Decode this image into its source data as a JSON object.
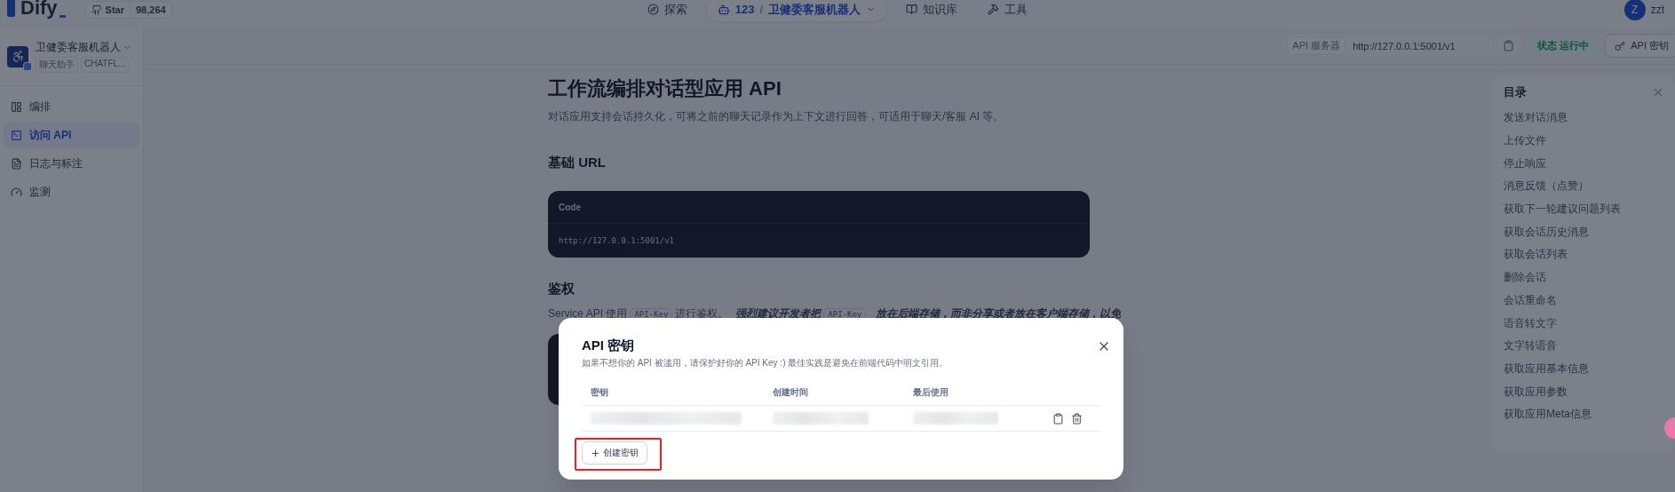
{
  "top_nav": {
    "logo": "Dify",
    "star": {
      "label": "Star",
      "count": "98,264"
    },
    "items": [
      {
        "kind": "explore",
        "label": "探索",
        "selected": false
      },
      {
        "kind": "app",
        "count": "123",
        "separator": "/",
        "label": "卫健委客服机器人",
        "selected": true
      },
      {
        "kind": "knowledge",
        "label": "知识库",
        "selected": false
      },
      {
        "kind": "tools",
        "label": "工具",
        "selected": false
      }
    ],
    "user": {
      "initial": "Z",
      "name": "zzt"
    }
  },
  "sidebar": {
    "app": {
      "name": "卫健委客服机器人",
      "tags": [
        "聊天助手",
        "CHATFL..."
      ]
    },
    "items": [
      {
        "kind": "orchestrate",
        "label": "编排",
        "selected": false
      },
      {
        "kind": "api",
        "label": "访问 API",
        "selected": true
      },
      {
        "kind": "logs",
        "label": "日志与标注",
        "selected": false
      },
      {
        "kind": "monitor",
        "label": "监测",
        "selected": false
      }
    ]
  },
  "header": {
    "server_label": "API 服务器",
    "server_url": "http://127.0.0.1:5001/v1",
    "status": {
      "label": "状态",
      "value": "运行中",
      "running": true
    },
    "key_button": "API 密钥"
  },
  "doc": {
    "title": "工作流编排对话型应用 API",
    "description": "对话应用支持会话持久化，可将之前的聊天记录作为上下文进行回答，可适用于聊天/客服 AI 等。",
    "base_url": {
      "heading": "基础 URL",
      "code_label": "Code",
      "code": "http://127.0.0.1:5001/v1"
    },
    "auth": {
      "heading": "鉴权",
      "segments": [
        {
          "kind": "text",
          "text": "Service API 使用"
        },
        {
          "kind": "code",
          "text": "API-Key"
        },
        {
          "kind": "text",
          "text": "进行鉴权。"
        },
        {
          "kind": "strong",
          "text": "强烈建议开发者把"
        },
        {
          "kind": "code",
          "text": "API-Key"
        },
        {
          "kind": "strong",
          "text": "放在后端存储，而非分享或者放在客户端存储，以免"
        }
      ]
    }
  },
  "toc": {
    "title": "目录",
    "items": [
      "发送对话消息",
      "上传文件",
      "停止响应",
      "消息反馈（点赞）",
      "获取下一轮建议问题列表",
      "获取会话历史消息",
      "获取会话列表",
      "删除会话",
      "会话重命名",
      "语音转文字",
      "文字转语音",
      "获取应用基本信息",
      "获取应用参数",
      "获取应用Meta信息"
    ]
  },
  "modal": {
    "title": "API 密钥",
    "description": "如果不想你的 API 被滥用，请保护好你的 API Key :) 最佳实践是避免在前端代码中明文引用。",
    "columns": [
      "密钥",
      "创建时间",
      "最后使用"
    ],
    "rows": [
      {
        "kind": "blurred"
      }
    ],
    "create_button": "创建密钥",
    "create_highlighted": true
  }
}
